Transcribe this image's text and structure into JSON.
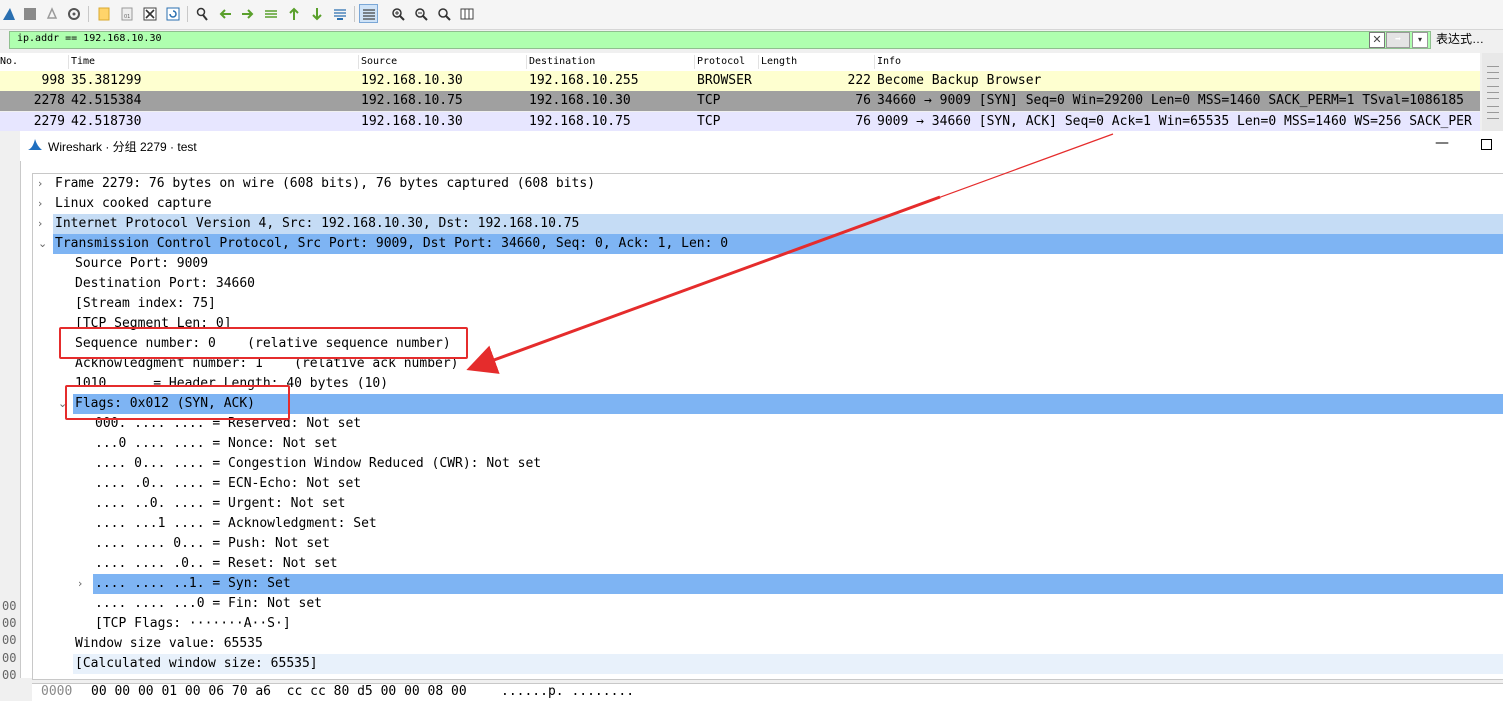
{
  "filter": {
    "value": "ip.addr == 192.168.10.30",
    "clear_glyph": "✕",
    "apply_glyph": "➡",
    "dropdown_glyph": "▾",
    "expression_label": "表达式…"
  },
  "columns": [
    "No.",
    "Time",
    "Source",
    "Destination",
    "Protocol",
    "Length",
    "Info"
  ],
  "packets": [
    {
      "no": "998",
      "time": "35.381299",
      "source": "192.168.10.30",
      "destination": "192.168.10.255",
      "protocol": "BROWSER",
      "length": "222",
      "info": "Become Backup Browser",
      "bg": "#feffd0"
    },
    {
      "no": "2278",
      "time": "42.515384",
      "source": "192.168.10.75",
      "destination": "192.168.10.30",
      "protocol": "TCP",
      "length": "76",
      "info": "34660 → 9009 [SYN] Seq=0 Win=29200 Len=0 MSS=1460 SACK_PERM=1 TSval=1086185",
      "bg": "#a0a0a0"
    },
    {
      "no": "2279",
      "time": "42.518730",
      "source": "192.168.10.30",
      "destination": "192.168.10.75",
      "protocol": "TCP",
      "length": "76",
      "info": "9009 → 34660 [SYN, ACK] Seq=0 Ack=1 Win=65535 Len=0 MSS=1460 WS=256 SACK_PER",
      "bg": "#e7e6ff"
    }
  ],
  "dialog": {
    "title": "Wireshark · 分组 2279 · test",
    "minimize_glyph": "—"
  },
  "tree": [
    {
      "text": "Frame 2279: 76 bytes on wire (608 bits), 76 bytes captured (608 bits)",
      "indent": 0,
      "arrow": "›",
      "bg": "#ffffff"
    },
    {
      "text": "Linux cooked capture",
      "indent": 0,
      "arrow": "›",
      "bg": "#ffffff"
    },
    {
      "text": "Internet Protocol Version 4, Src: 192.168.10.30, Dst: 192.168.10.75",
      "indent": 0,
      "arrow": "›",
      "bg": "#c5dcf5"
    },
    {
      "text": "Transmission Control Protocol, Src Port: 9009, Dst Port: 34660, Seq: 0, Ack: 1, Len: 0",
      "indent": 0,
      "arrow": "⌄",
      "bg": "#7eb4f3"
    },
    {
      "text": "Source Port: 9009",
      "indent": 1,
      "arrow": "",
      "bg": "#ffffff"
    },
    {
      "text": "Destination Port: 34660",
      "indent": 1,
      "arrow": "",
      "bg": "#ffffff"
    },
    {
      "text": "[Stream index: 75]",
      "indent": 1,
      "arrow": "",
      "bg": "#ffffff"
    },
    {
      "text": "[TCP Segment Len: 0]",
      "indent": 1,
      "arrow": "",
      "bg": "#ffffff"
    },
    {
      "text": "Sequence number: 0    (relative sequence number)",
      "indent": 1,
      "arrow": "",
      "bg": "#ffffff"
    },
    {
      "text": "Acknowledgment number: 1    (relative ack number)",
      "indent": 1,
      "arrow": "",
      "bg": "#ffffff"
    },
    {
      "text": "1010 .... = Header Length: 40 bytes (10)",
      "indent": 1,
      "arrow": "",
      "bg": "#ffffff"
    },
    {
      "text": "Flags: 0x012 (SYN, ACK)",
      "indent": 1,
      "arrow": "⌄",
      "bg": "#7eb4f3"
    },
    {
      "text": "000. .... .... = Reserved: Not set",
      "indent": 2,
      "arrow": "",
      "bg": "#ffffff"
    },
    {
      "text": "...0 .... .... = Nonce: Not set",
      "indent": 2,
      "arrow": "",
      "bg": "#ffffff"
    },
    {
      "text": ".... 0... .... = Congestion Window Reduced (CWR): Not set",
      "indent": 2,
      "arrow": "",
      "bg": "#ffffff"
    },
    {
      "text": ".... .0.. .... = ECN-Echo: Not set",
      "indent": 2,
      "arrow": "",
      "bg": "#ffffff"
    },
    {
      "text": ".... ..0. .... = Urgent: Not set",
      "indent": 2,
      "arrow": "",
      "bg": "#ffffff"
    },
    {
      "text": ".... ...1 .... = Acknowledgment: Set",
      "indent": 2,
      "arrow": "",
      "bg": "#ffffff"
    },
    {
      "text": ".... .... 0... = Push: Not set",
      "indent": 2,
      "arrow": "",
      "bg": "#ffffff"
    },
    {
      "text": ".... .... .0.. = Reset: Not set",
      "indent": 2,
      "arrow": "",
      "bg": "#ffffff"
    },
    {
      "text": ".... .... ..1. = Syn: Set",
      "indent": 2,
      "arrow": "›",
      "bg": "#7eb4f3"
    },
    {
      "text": ".... .... ...0 = Fin: Not set",
      "indent": 2,
      "arrow": "",
      "bg": "#ffffff"
    },
    {
      "text": "[TCP Flags: ·······A··S·]",
      "indent": 2,
      "arrow": "",
      "bg": "#ffffff"
    },
    {
      "text": "Window size value: 65535",
      "indent": 1,
      "arrow": "",
      "bg": "#ffffff"
    },
    {
      "text": "[Calculated window size: 65535]",
      "indent": 1,
      "arrow": "",
      "bg": "#e8f1fb"
    }
  ],
  "hex": {
    "offset": "0000",
    "bytes": "00 00 00 01 00 06 70 a6  cc cc 80 d5 00 00 08 00",
    "ascii": "......p. ........"
  },
  "left_sliver": {
    "prefix": "No.",
    "numbers": [
      "00",
      "00",
      "00",
      "00",
      "00"
    ]
  },
  "colors": {
    "annotation": "#e52c2c",
    "selected_row": "#7eb4f3",
    "filter_ok": "#afffaf"
  },
  "toolbar_icons": [
    "shark-fin-icon",
    "stop-icon",
    "restart-icon",
    "options-icon",
    "open-icon",
    "save-icon",
    "close-file-icon",
    "reload-icon",
    "find-icon",
    "back-icon",
    "forward-icon",
    "goto-packet-icon",
    "first-packet-icon",
    "last-packet-icon",
    "autoscroll-icon",
    "colorize-icon",
    "zoom-in-icon",
    "zoom-out-icon",
    "zoom-reset-icon",
    "resize-columns-icon"
  ]
}
